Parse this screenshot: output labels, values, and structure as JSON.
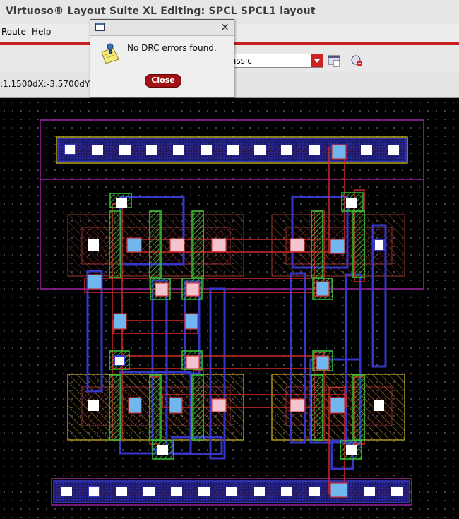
{
  "window": {
    "title": "Virtuoso® Layout Suite XL Editing: SPCL SPCL1 layout"
  },
  "menu": {
    "items": [
      {
        "label": "Route"
      },
      {
        "label": "Help"
      }
    ]
  },
  "toolbar": {
    "view_select": {
      "value": "assic"
    }
  },
  "status": {
    "coords": ":1.1500dX:-3.5700dY:"
  },
  "dialog": {
    "message": "No DRC errors found.",
    "close_label": "Close"
  },
  "icons": {
    "dialog_icon": "window-icon",
    "message_icon": "note-icon"
  },
  "colors": {
    "accent_red": "#c41e1e",
    "metal1": "#3a3ac8",
    "poly": "#cc2020",
    "diffusion": "#22aa22",
    "nwell": "#a020a0",
    "contact": "#6fb7ee"
  }
}
